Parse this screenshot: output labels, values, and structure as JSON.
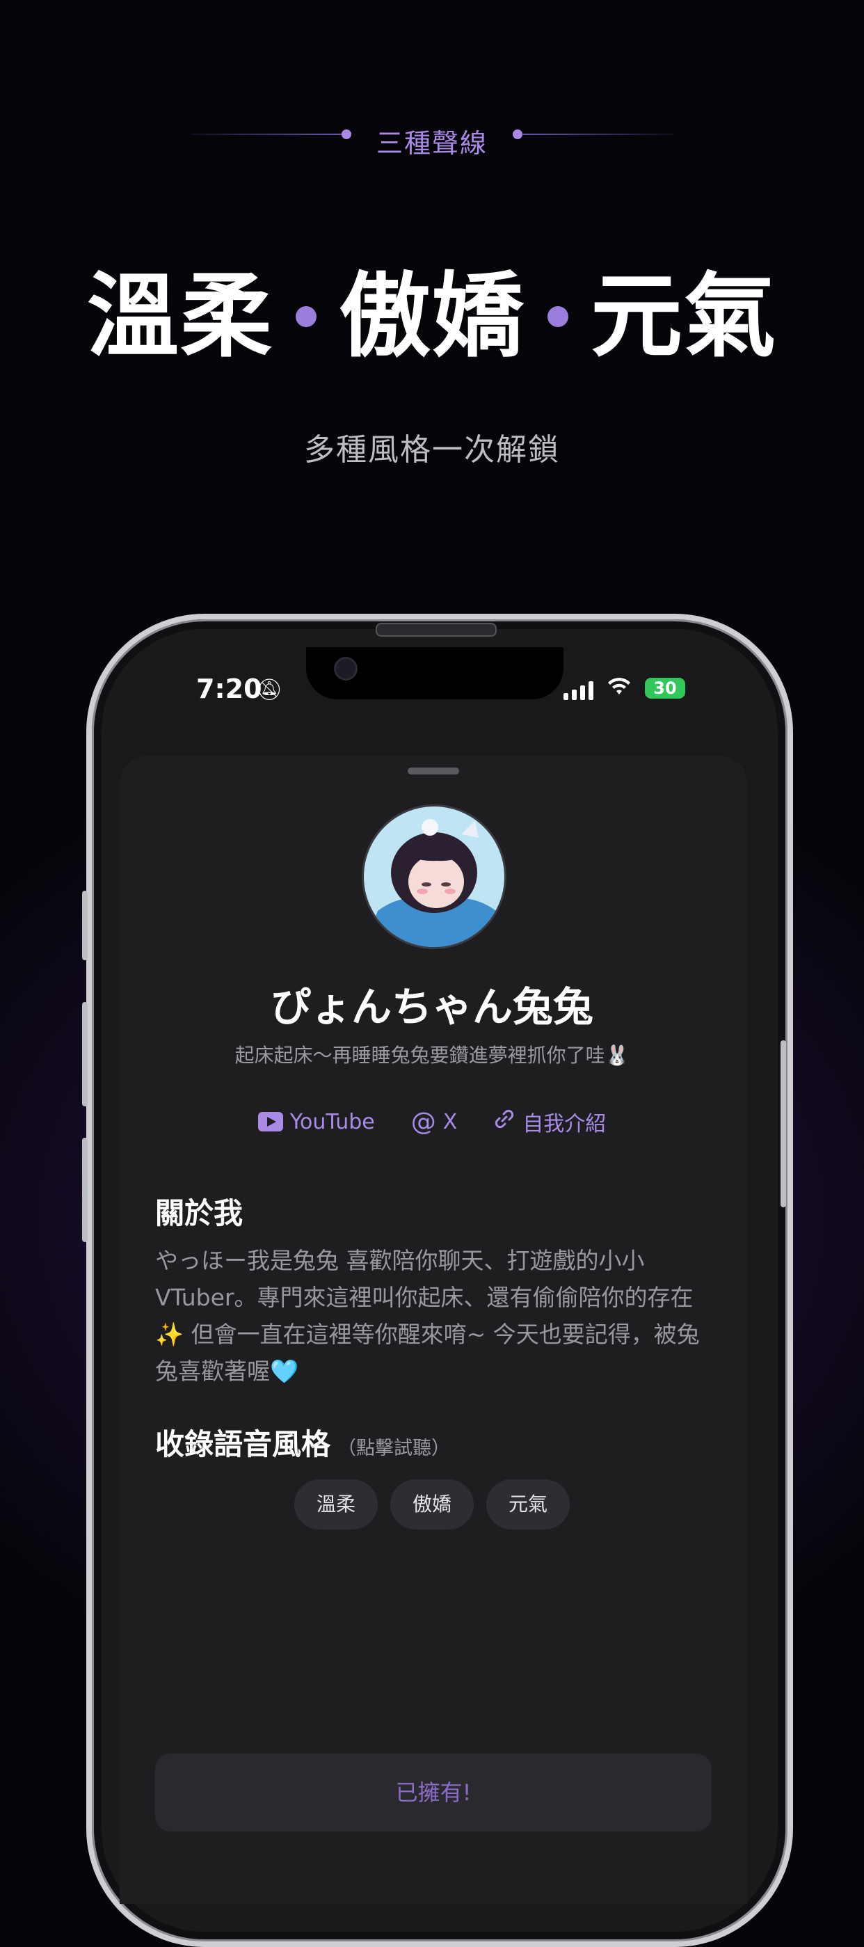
{
  "header": {
    "eyebrow": "三種聲線",
    "headline": [
      "溫柔",
      "傲嬌",
      "元氣"
    ],
    "subtitle": "多種風格一次解鎖"
  },
  "status_bar": {
    "time": "7:20",
    "battery": "30"
  },
  "profile": {
    "name": "ぴょんちゃん兔兔",
    "tagline": "起床起床～再睡睡兔兔要鑽進夢裡抓你了哇🐰",
    "links": [
      {
        "label": "YouTube",
        "icon": "youtube-icon"
      },
      {
        "label": "X",
        "icon": "at-icon"
      },
      {
        "label": "自我介紹",
        "icon": "link-icon"
      }
    ]
  },
  "about": {
    "title": "關於我",
    "text": "やっほー我是兔兔 喜歡陪你聊天、打遊戲的小小VTuber。專門來這裡叫你起床、還有偷偷陪你的存在✨ 但會一直在這裡等你醒來唷~ 今天也要記得，被兔兔喜歡著喔🩵"
  },
  "voice_styles": {
    "title": "收錄語音風格",
    "note": "（點擊試聽）",
    "chips": [
      "溫柔",
      "傲嬌",
      "元氣"
    ]
  },
  "cta": {
    "label": "已擁有!"
  },
  "colors": {
    "accent": "#a98be6",
    "background": "#050406",
    "sheet": "#1e1e21"
  }
}
